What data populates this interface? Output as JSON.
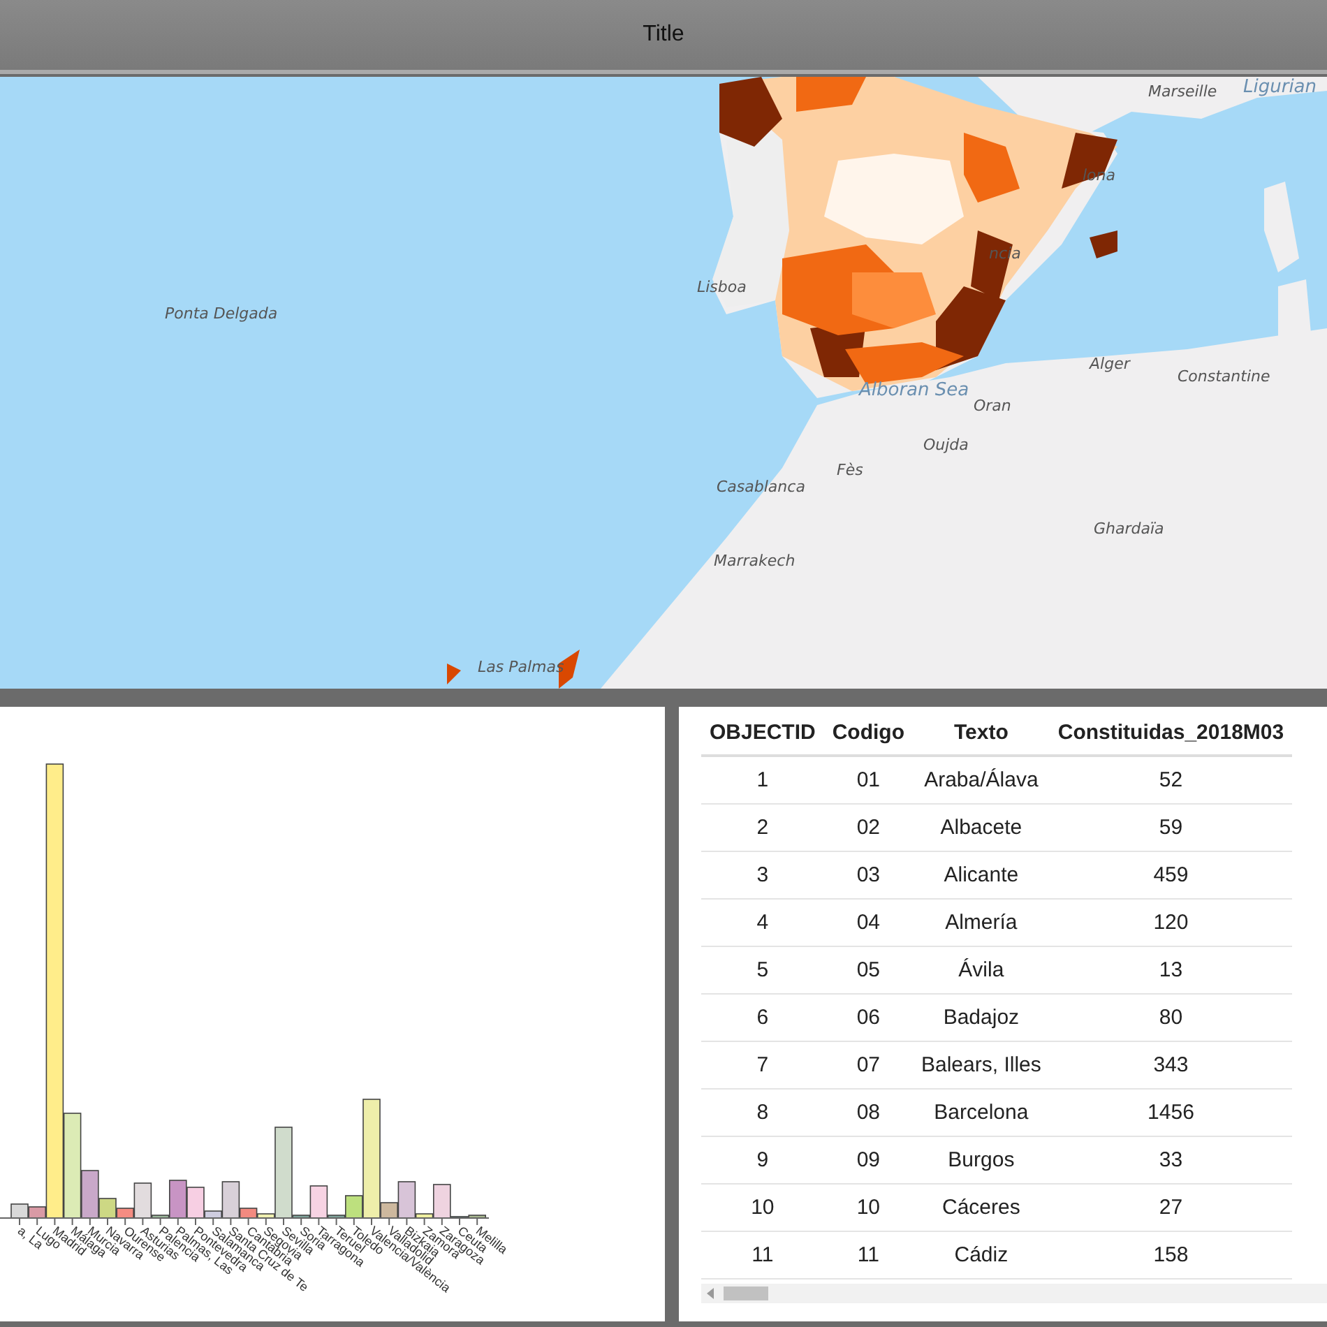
{
  "title_bar": {
    "title": "Title"
  },
  "map": {
    "labels": [
      "Marseille",
      "Ligurian",
      "lona",
      "ncia",
      "Lisboa",
      "Ponta Delgada",
      "Alger",
      "Constantine",
      "Alboran Sea",
      "Oran",
      "Oujda",
      "Fès",
      "Casablanca",
      "Ghardaïa",
      "Marrakech",
      "Las Palmas"
    ]
  },
  "bar_chart": {
    "categories": [
      "a, La",
      "Lugo",
      "Madrid",
      "Málaga",
      "Murcia",
      "Navarra",
      "Ourense",
      "Asturias",
      "Palencia",
      "Palmas, Las",
      "Pontevedra",
      "Salamanca",
      "Santa Cruz de Te",
      "Cantabria",
      "Segovia",
      "Sevilla",
      "Soria",
      "Tarragona",
      "Teruel",
      "Toledo",
      "Valencia/València",
      "Valladolid",
      "Bizkaia",
      "Zamora",
      "Zaragoza",
      "Ceuta",
      "Melilla"
    ]
  },
  "table": {
    "columns": [
      "OBJECTID",
      "Codigo",
      "Texto",
      "Constituidas_2018M03"
    ],
    "rows": [
      [
        "1",
        "01",
        "Araba/Álava",
        "52"
      ],
      [
        "2",
        "02",
        "Albacete",
        "59"
      ],
      [
        "3",
        "03",
        "Alicante",
        "459"
      ],
      [
        "4",
        "04",
        "Almería",
        "120"
      ],
      [
        "5",
        "05",
        "Ávila",
        "13"
      ],
      [
        "6",
        "06",
        "Badajoz",
        "80"
      ],
      [
        "7",
        "07",
        "Balears, Illes",
        "343"
      ],
      [
        "8",
        "08",
        "Barcelona",
        "1456"
      ],
      [
        "9",
        "09",
        "Burgos",
        "33"
      ],
      [
        "10",
        "10",
        "Cáceres",
        "27"
      ],
      [
        "11",
        "11",
        "Cádiz",
        "158"
      ]
    ]
  }
}
